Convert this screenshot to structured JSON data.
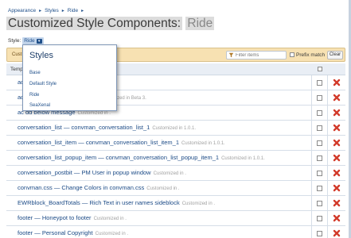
{
  "breadcrumb": [
    "Appearance",
    "Styles",
    "Ride"
  ],
  "title": {
    "prefix": "Customized Style Components:",
    "style_name": "Ride"
  },
  "style_selector": {
    "label": "Style:",
    "value": "Ride"
  },
  "filter": {
    "label": "Cust",
    "placeholder": "Filter items",
    "prefix_match_label": "Prefix match",
    "clear_label": "Clear"
  },
  "list": {
    "header_label": "Temp",
    "rows": [
      {
        "title": "ac",
        "note": "Customized in 0.6.3."
      },
      {
        "title": "ac                              _wrapper_sidebar_settings",
        "note": "Customized in Beta 3."
      },
      {
        "title": "ac                               dd below message",
        "note": "Customized in ."
      },
      {
        "title": "conversation_list — convman_conversation_list_1",
        "note": "Customized in 1.0.1."
      },
      {
        "title": "conversation_list_item — convman_conversation_list_item_1",
        "note": "Customized in 1.0.1."
      },
      {
        "title": "conversation_list_popup_item — convman_conversation_list_popup_item_1",
        "note": "Customized in 1.0.1."
      },
      {
        "title": "conversation_postbit — PM User in popup window",
        "note": "Customized in ."
      },
      {
        "title": "convman.css — Change Colors in convman.css",
        "note": "Customized in ."
      },
      {
        "title": "EWRblock_BoardTotals — Rich Text in user names sideblock",
        "note": "Customized in ."
      },
      {
        "title": "footer — Honeypot to footer",
        "note": "Customized in ."
      },
      {
        "title": "footer — Personal Copyright",
        "note": "Customized in ."
      }
    ]
  },
  "styles_popup": {
    "title": "Styles",
    "options": [
      "Base",
      "Default Style",
      "Ride",
      "SeaXenal"
    ]
  },
  "colors": {
    "link": "#1b4a86",
    "delete_red": "#d23a2a",
    "filter_bar": "#f7e1b2"
  }
}
